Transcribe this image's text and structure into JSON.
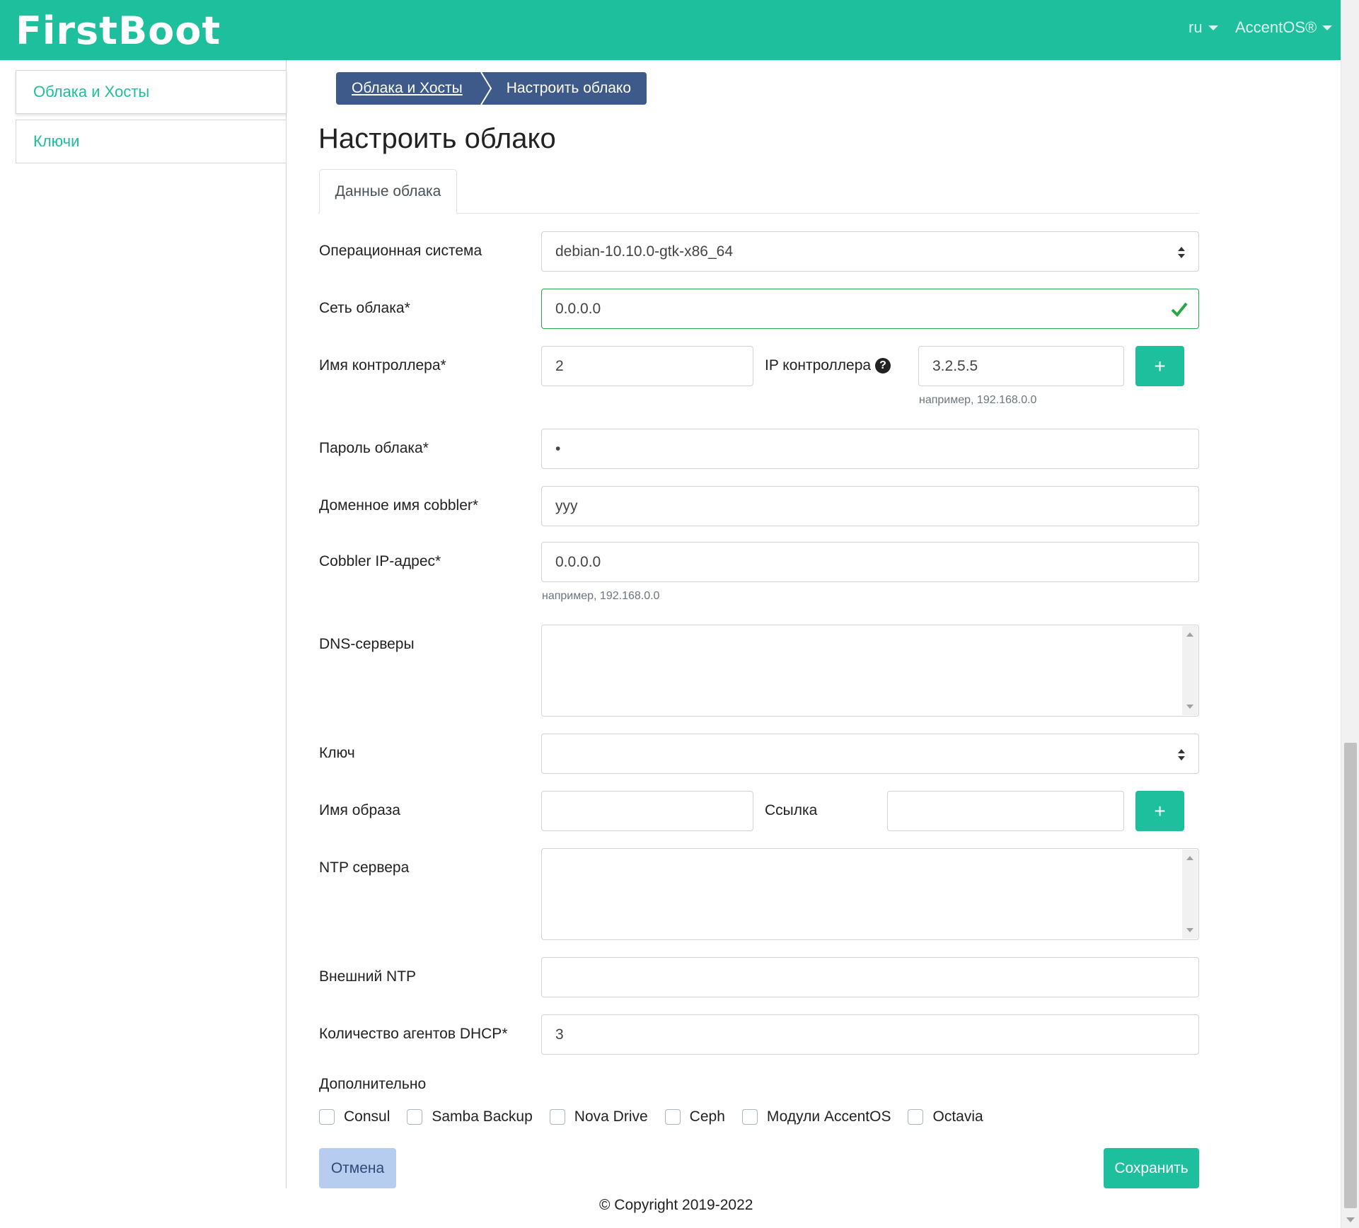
{
  "header": {
    "brand": "FirstBoot",
    "language": "ru",
    "user": "AccentOS®"
  },
  "sidebar": {
    "items": [
      {
        "label": "Облака и Хосты"
      },
      {
        "label": "Ключи"
      }
    ]
  },
  "breadcrumb": {
    "items": [
      "Облака и Хосты",
      "Настроить облако"
    ]
  },
  "page": {
    "title": "Настроить облако",
    "tab": "Данные облака"
  },
  "form": {
    "os": {
      "label": "Операционная система",
      "value": "debian-10.10.0-gtk-x86_64"
    },
    "network": {
      "label": "Сеть облака*",
      "value": "0.0.0.0"
    },
    "controller_name": {
      "label": "Имя контроллера*",
      "value": "2"
    },
    "controller_ip": {
      "label": "IP контроллера",
      "value": "3.2.5.5",
      "hint": "например, 192.168.0.0"
    },
    "password": {
      "label": "Пароль облака*",
      "value": "•"
    },
    "cobbler_domain": {
      "label": "Доменное имя cobbler*",
      "value": "yyy"
    },
    "cobbler_ip": {
      "label": "Cobbler IP-адрес*",
      "value": "0.0.0.0",
      "hint": "например, 192.168.0.0"
    },
    "dns": {
      "label": "DNS-серверы",
      "value": ""
    },
    "key": {
      "label": "Ключ",
      "value": ""
    },
    "image_name": {
      "label": "Имя образа",
      "value": ""
    },
    "link": {
      "label": "Ссылка",
      "value": ""
    },
    "ntp": {
      "label": "NTP сервера",
      "value": ""
    },
    "external_ntp": {
      "label": "Внешний NTP",
      "value": ""
    },
    "dhcp_agents": {
      "label": "Количество агентов DHCP*",
      "value": "3"
    },
    "additional": {
      "label": "Дополнительно",
      "options": [
        "Consul",
        "Samba Backup",
        "Nova Drive",
        "Ceph",
        "Модули AccentOS",
        "Octavia"
      ]
    },
    "plus_symbol": "+",
    "help_symbol": "?"
  },
  "buttons": {
    "cancel": "Отмена",
    "save": "Сохранить"
  },
  "footer": {
    "copyright": "© Copyright 2019-2022"
  },
  "colors": {
    "accent": "#1dbf9c",
    "breadcrumb": "#3d5a8a",
    "valid": "#28a745",
    "cancel_bg": "#b7cdf0"
  }
}
